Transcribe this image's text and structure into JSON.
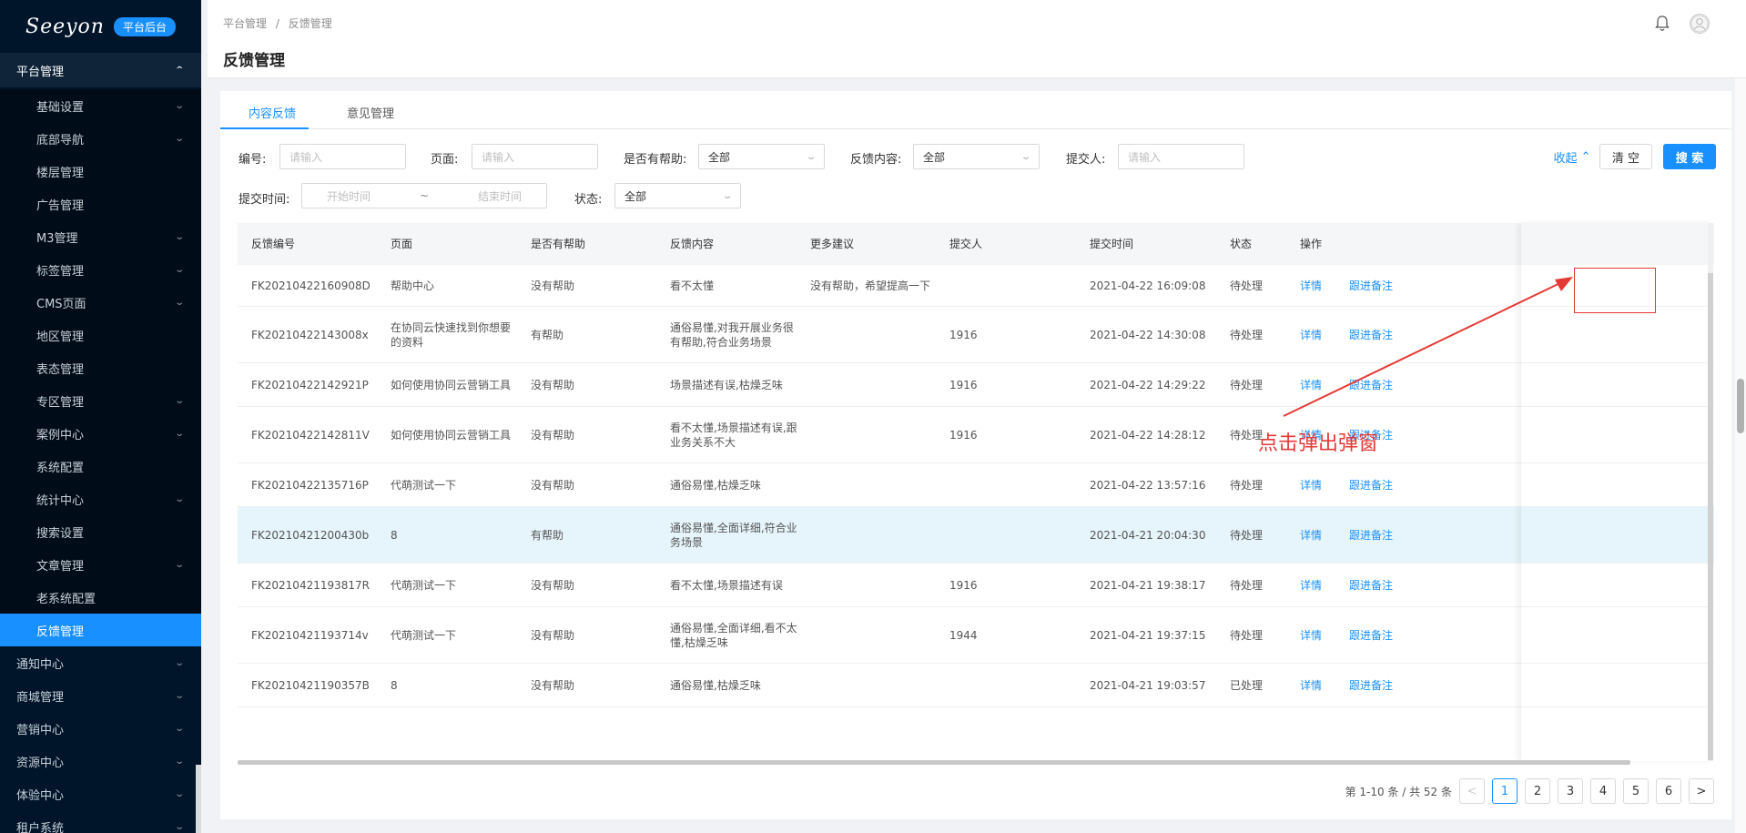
{
  "sidebar": {
    "logo": "Seeyon",
    "badge": "平台后台",
    "group_title": "平台管理",
    "sub_items": [
      {
        "label": "基础设置",
        "chevron": true
      },
      {
        "label": "底部导航",
        "chevron": true
      },
      {
        "label": "楼层管理",
        "chevron": false
      },
      {
        "label": "广告管理",
        "chevron": false
      },
      {
        "label": "M3管理",
        "chevron": true
      },
      {
        "label": "标签管理",
        "chevron": true
      },
      {
        "label": "CMS页面",
        "chevron": true
      },
      {
        "label": "地区管理",
        "chevron": false
      },
      {
        "label": "表态管理",
        "chevron": false
      },
      {
        "label": "专区管理",
        "chevron": true
      },
      {
        "label": "案例中心",
        "chevron": true
      },
      {
        "label": "系统配置",
        "chevron": false
      },
      {
        "label": "统计中心",
        "chevron": true
      },
      {
        "label": "搜索设置",
        "chevron": false
      },
      {
        "label": "文章管理",
        "chevron": true
      },
      {
        "label": "老系统配置",
        "chevron": false
      },
      {
        "label": "反馈管理",
        "chevron": false,
        "active": true
      }
    ],
    "top_items": [
      {
        "label": "通知中心"
      },
      {
        "label": "商城管理"
      },
      {
        "label": "营销中心"
      },
      {
        "label": "资源中心"
      },
      {
        "label": "体验中心"
      },
      {
        "label": "租户系统"
      }
    ]
  },
  "header": {
    "breadcrumb": [
      "平台管理",
      "/",
      "反馈管理"
    ],
    "title": "反馈管理",
    "icons": [
      "bell-icon",
      "user-icon"
    ]
  },
  "tabs": [
    {
      "label": "内容反馈",
      "active": true
    },
    {
      "label": "意见管理",
      "active": false
    }
  ],
  "filters": {
    "id_label": "编号:",
    "id_placeholder": "请输入",
    "page_label": "页面:",
    "page_placeholder": "请输入",
    "helpful_label": "是否有帮助:",
    "helpful_value": "全部",
    "content_label": "反馈内容:",
    "content_value": "全部",
    "submitter_label": "提交人:",
    "submitter_placeholder": "请输入",
    "time_label": "提交时间:",
    "time_start": "开始时间",
    "time_sep": "~",
    "time_end": "结束时间",
    "status_label": "状态:",
    "status_value": "全部",
    "collapse": "收起",
    "clear": "清 空",
    "search": "搜 索"
  },
  "table": {
    "columns": [
      "反馈编号",
      "页面",
      "是否有帮助",
      "反馈内容",
      "更多建议",
      "提交人",
      "提交时间",
      "状态",
      "操作"
    ],
    "action_detail": "详情",
    "action_follow": "跟进备注",
    "rows": [
      {
        "id": "FK20210422160908D",
        "page": "帮助中心",
        "helpful": "没有帮助",
        "content": "看不太懂",
        "suggest": "没有帮助，希望提高一下",
        "user": "",
        "time": "2021-04-22 16:09:08",
        "status": "待处理"
      },
      {
        "id": "FK20210422143008x",
        "page": "在协同云快速找到你想要的资料",
        "helpful": "有帮助",
        "content": "通俗易懂,对我开展业务很有帮助,符合业务场景",
        "suggest": "",
        "user": "1916",
        "time": "2021-04-22 14:30:08",
        "status": "待处理"
      },
      {
        "id": "FK20210422142921P",
        "page": "如何使用协同云营销工具",
        "helpful": "没有帮助",
        "content": "场景描述有误,枯燥乏味",
        "suggest": "",
        "user": "1916",
        "time": "2021-04-22 14:29:22",
        "status": "待处理"
      },
      {
        "id": "FK20210422142811V",
        "page": "如何使用协同云营销工具",
        "helpful": "没有帮助",
        "content": "看不太懂,场景描述有误,跟业务关系不大",
        "suggest": "",
        "user": "1916",
        "time": "2021-04-22 14:28:12",
        "status": "待处理"
      },
      {
        "id": "FK20210422135716P",
        "page": "代萌测试一下",
        "helpful": "没有帮助",
        "content": "通俗易懂,枯燥乏味",
        "suggest": "",
        "user": "",
        "time": "2021-04-22 13:57:16",
        "status": "待处理"
      },
      {
        "id": "FK20210421200430b",
        "page": "8",
        "helpful": "有帮助",
        "content": "通俗易懂,全面详细,符合业务场景",
        "suggest": "",
        "user": "",
        "time": "2021-04-21 20:04:30",
        "status": "待处理"
      },
      {
        "id": "FK20210421193817R",
        "page": "代萌测试一下",
        "helpful": "没有帮助",
        "content": "看不太懂,场景描述有误",
        "suggest": "",
        "user": "1916",
        "time": "2021-04-21 19:38:17",
        "status": "待处理"
      },
      {
        "id": "FK20210421193714v",
        "page": "代萌测试一下",
        "helpful": "没有帮助",
        "content": "通俗易懂,全面详细,看不太懂,枯燥乏味",
        "suggest": "",
        "user": "1944",
        "time": "2021-04-21 19:37:15",
        "status": "待处理"
      },
      {
        "id": "FK20210421190357B",
        "page": "8",
        "helpful": "没有帮助",
        "content": "通俗易懂,枯燥乏味",
        "suggest": "",
        "user": "",
        "time": "2021-04-21 19:03:57",
        "status": "已处理"
      }
    ]
  },
  "pagination": {
    "summary": "第 1-10 条 / 共 52 条",
    "pages": [
      "1",
      "2",
      "3",
      "4",
      "5",
      "6"
    ],
    "current": "1",
    "prev": "<",
    "next": ">"
  },
  "annotation": {
    "text": "点击弹出弹窗",
    "color": "#e53935"
  },
  "colors": {
    "accent": "#1890ff",
    "sidebar_bg": "#001529",
    "highlight_row": "#e6f4fb"
  }
}
